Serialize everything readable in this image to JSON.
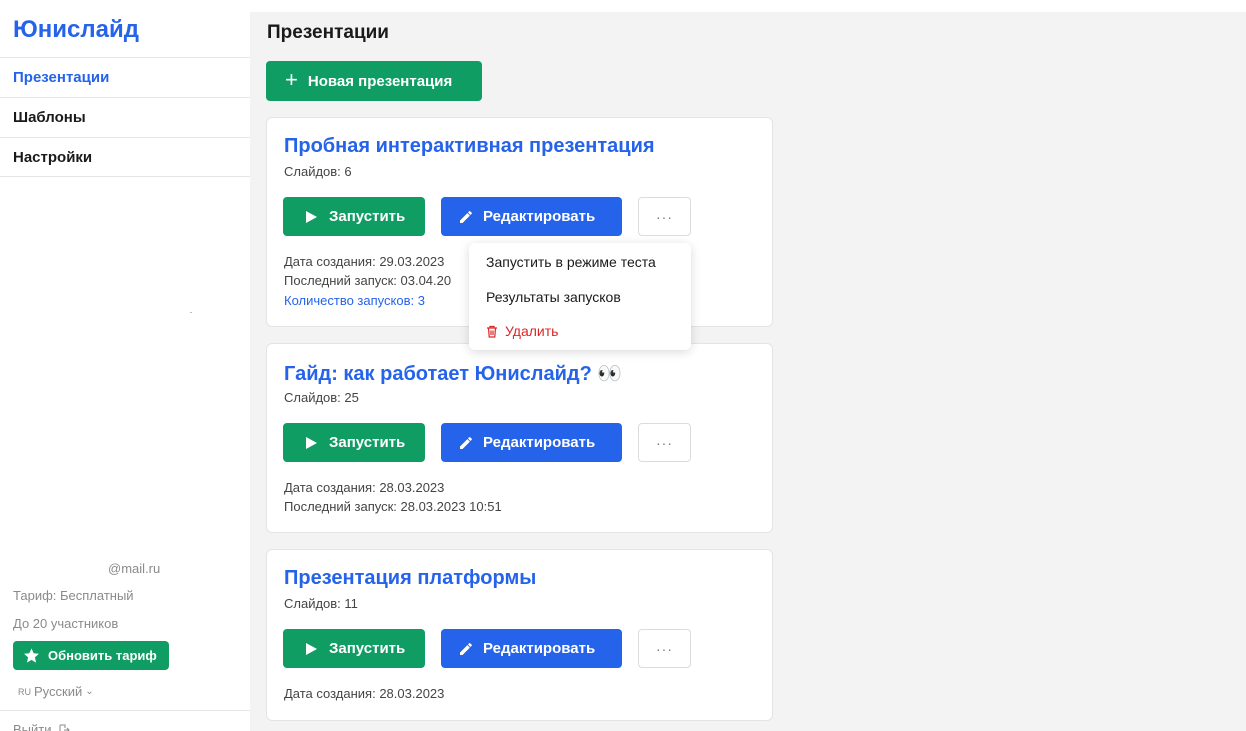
{
  "app": {
    "logo": "Юнислайд"
  },
  "nav": {
    "items": [
      {
        "label": "Презентации",
        "active": true
      },
      {
        "label": "Шаблоны",
        "active": false
      },
      {
        "label": "Настройки",
        "active": false
      }
    ]
  },
  "account": {
    "email": "@mail.ru",
    "plan": "Тариф: Бесплатный",
    "limit": "До 20 участников",
    "upgrade_label": "Обновить тариф",
    "lang_code": "RU",
    "lang_label": "Русский",
    "logout_label": "Выйти"
  },
  "main": {
    "title": "Презентации",
    "new_button_label": "Новая презентация",
    "run_label": "Запустить",
    "edit_label": "Редактировать",
    "more_label": "···"
  },
  "presentations": [
    {
      "title": "Пробная интерактивная презентация",
      "slides": "Слайдов: 6",
      "created": "Дата создания: 29.03.2023",
      "last_run": "Последний запуск: 03.04.20",
      "runs": "Количество запусков: 3"
    },
    {
      "title": "Гайд: как работает Юнислайд?",
      "title_emoji": "👀",
      "slides": "Слайдов: 25",
      "created": "Дата создания: 28.03.2023",
      "last_run": "Последний запуск: 28.03.2023 10:51"
    },
    {
      "title": "Презентация платформы",
      "slides": "Слайдов: 11",
      "created": "Дата создания: 28.03.2023"
    }
  ],
  "dropdown": {
    "items": [
      {
        "label": "Запустить в режиме теста"
      },
      {
        "label": "Результаты запусков"
      },
      {
        "label": "Удалить",
        "danger": true
      }
    ]
  },
  "colors": {
    "brand_blue": "#2563eb",
    "brand_green": "#0f9d64",
    "danger": "#dc2626"
  }
}
